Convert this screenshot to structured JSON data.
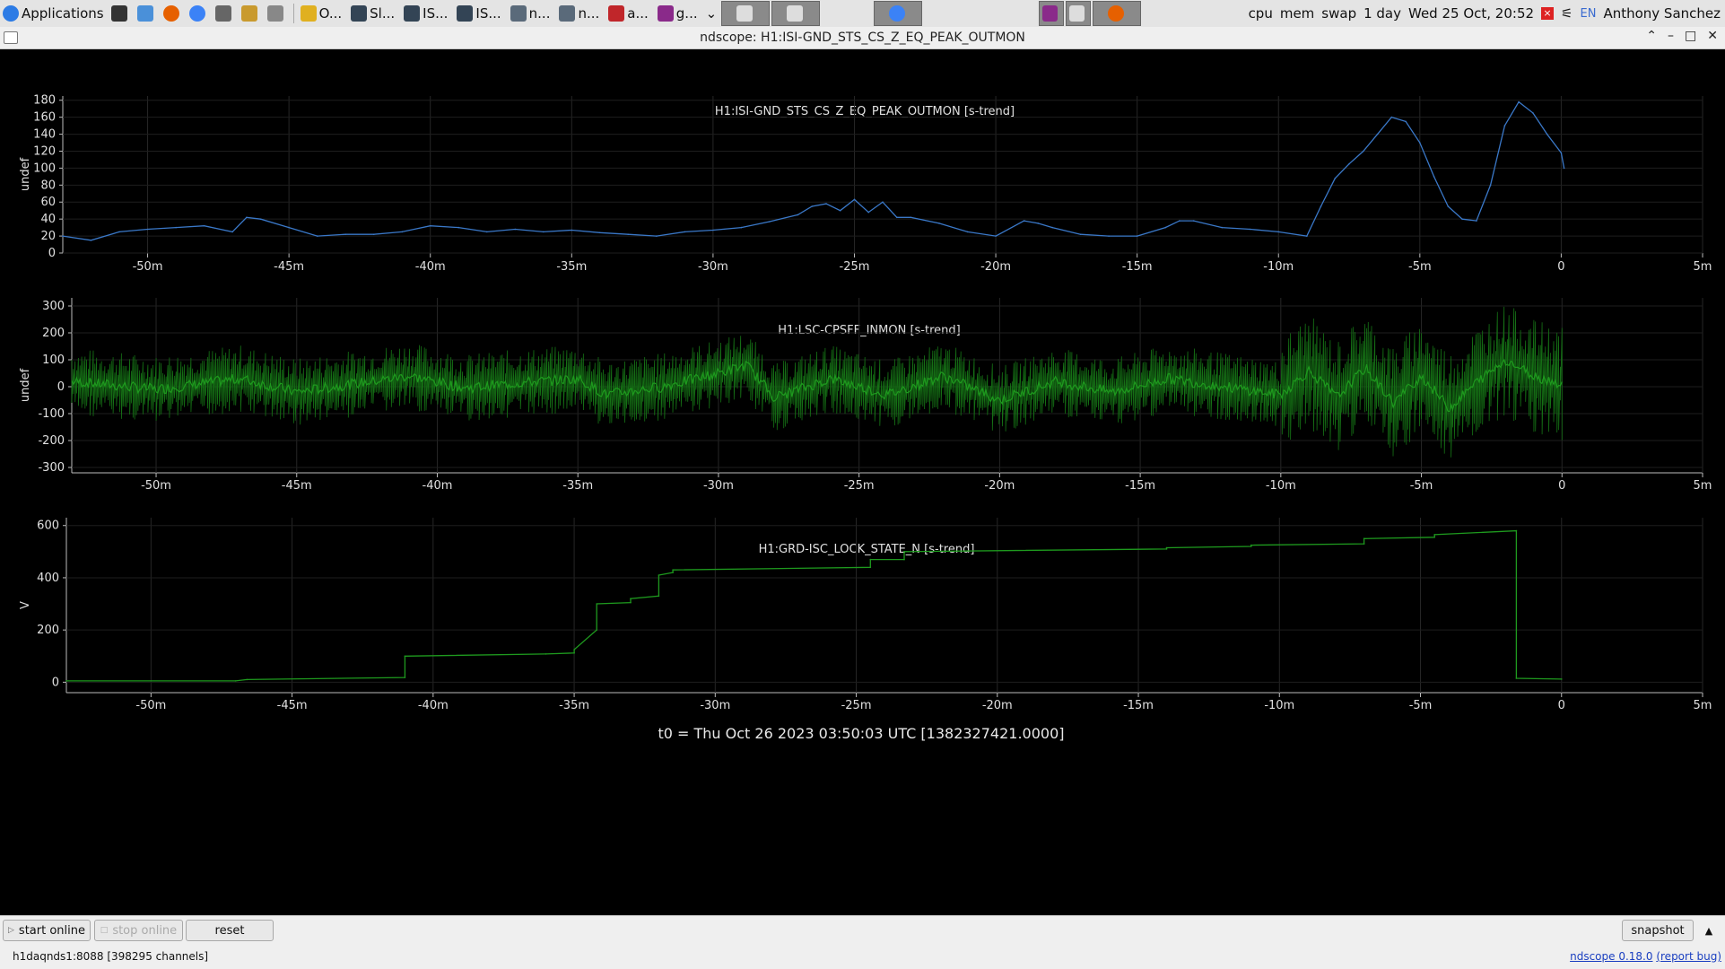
{
  "taskbar": {
    "apps_label": "Applications",
    "windows": [
      {
        "label": "O...",
        "icon": "editor-icon"
      },
      {
        "label": "Sl...",
        "icon": "monitor-icon"
      },
      {
        "label": "IS...",
        "icon": "monitor-icon"
      },
      {
        "label": "IS...",
        "icon": "monitor-icon"
      },
      {
        "label": "n...",
        "icon": "window-icon"
      },
      {
        "label": "n...",
        "icon": "window-icon"
      },
      {
        "label": "a...",
        "icon": "app-icon"
      },
      {
        "label": "g...",
        "icon": "app-icon"
      }
    ],
    "cpu": "cpu",
    "mem": "mem",
    "swap": "swap",
    "uptime": "1 day",
    "clock": "Wed 25 Oct, 20:52",
    "lang": "EN",
    "user": "Anthony Sanchez"
  },
  "window": {
    "title": "ndscope: H1:ISI-GND_STS_CS_Z_EQ_PEAK_OUTMON"
  },
  "t0_label": "t0 = Thu Oct 26 2023 03:50:03 UTC [1382327421.0000]",
  "x_ticks": [
    "-50m",
    "-45m",
    "-40m",
    "-35m",
    "-30m",
    "-25m",
    "-20m",
    "-15m",
    "-10m",
    "-5m",
    "0",
    "5m"
  ],
  "chart_data": [
    {
      "type": "line",
      "title": "H1:ISI-GND_STS_CS_Z_EQ_PEAK_OUTMON [s-trend]",
      "ylabel": "undef",
      "color": "#3a78c8",
      "xlim": [
        -53,
        5
      ],
      "ylim": [
        0,
        185
      ],
      "yticks": [
        "0",
        "20",
        "40",
        "60",
        "80",
        "100",
        "120",
        "140",
        "160",
        "180"
      ],
      "x": [
        -53,
        -52,
        -51,
        -50,
        -49,
        -48,
        -47,
        -46.5,
        -46,
        -45,
        -44,
        -43,
        -42,
        -41,
        -40,
        -39,
        -38,
        -37,
        -36,
        -35,
        -34,
        -33,
        -32,
        -31,
        -30,
        -29,
        -28,
        -27,
        -26.5,
        -26,
        -25.5,
        -25,
        -24.5,
        -24,
        -23.5,
        -23,
        -22,
        -21,
        -20,
        -19,
        -18.5,
        -18,
        -17,
        -16,
        -15,
        -14,
        -13.5,
        -13,
        -12,
        -11,
        -10,
        -9,
        -8.5,
        -8,
        -7.5,
        -7,
        -6.5,
        -6,
        -5.5,
        -5,
        -4.5,
        -4,
        -3.5,
        -3,
        -2.5,
        -2,
        -1.5,
        -1,
        -0.5,
        0,
        0.1
      ],
      "y": [
        20,
        15,
        25,
        28,
        30,
        32,
        25,
        42,
        40,
        30,
        20,
        22,
        22,
        25,
        32,
        30,
        25,
        28,
        25,
        27,
        24,
        22,
        20,
        25,
        27,
        30,
        37,
        45,
        55,
        58,
        50,
        63,
        48,
        60,
        42,
        42,
        35,
        25,
        20,
        38,
        35,
        30,
        22,
        20,
        20,
        30,
        38,
        38,
        30,
        28,
        25,
        20,
        55,
        88,
        105,
        120,
        140,
        160,
        155,
        130,
        90,
        55,
        40,
        38,
        80,
        150,
        178,
        165,
        140,
        118,
        100,
        95
      ]
    },
    {
      "type": "line",
      "title": "H1:LSC-CPSFF_INMON [s-trend]",
      "ylabel": "undef",
      "color": "#1e9a1e",
      "xlim": [
        -53,
        5
      ],
      "ylim": [
        -320,
        330
      ],
      "yticks": [
        "300",
        "200",
        "100",
        "0",
        "-100",
        "-200",
        "-300"
      ],
      "x": [
        -53,
        -50,
        -47,
        -45,
        -43,
        -41,
        -39,
        -37,
        -35,
        -34,
        -32,
        -30,
        -29,
        -28,
        -26,
        -24,
        -22,
        -20,
        -18,
        -16,
        -14,
        -12,
        -10,
        -9,
        -8,
        -7,
        -6,
        -5,
        -4,
        -3,
        -2,
        -1,
        0
      ],
      "y": [
        20,
        -10,
        30,
        -20,
        10,
        40,
        -5,
        15,
        30,
        -30,
        0,
        50,
        80,
        -40,
        30,
        -30,
        40,
        -50,
        20,
        -20,
        30,
        0,
        -30,
        60,
        -40,
        70,
        -60,
        40,
        -80,
        20,
        100,
        40,
        10
      ]
    },
    {
      "type": "line",
      "title": "H1:GRD-ISC_LOCK_STATE_N [s-trend]",
      "ylabel": "V",
      "color": "#1e9a1e",
      "xlim": [
        -53,
        5
      ],
      "ylim": [
        -40,
        630
      ],
      "yticks": [
        "600",
        "400",
        "200",
        "0"
      ],
      "x": [
        -53,
        -47,
        -46.6,
        -41,
        -41,
        -36,
        -35,
        -35,
        -34.2,
        -34.2,
        -33,
        -33,
        -32,
        -32,
        -31.5,
        -31.5,
        -24.5,
        -24.5,
        -23.3,
        -23.3,
        -14,
        -14,
        -11,
        -11,
        -7,
        -7,
        -4.5,
        -4.5,
        -1.6,
        -1.6,
        0
      ],
      "y": [
        5,
        5,
        10,
        18,
        100,
        108,
        112,
        125,
        200,
        300,
        305,
        320,
        330,
        410,
        420,
        430,
        440,
        470,
        470,
        500,
        510,
        515,
        520,
        525,
        530,
        550,
        555,
        565,
        580,
        15,
        12
      ]
    }
  ],
  "buttons": {
    "start_online": "start online",
    "stop_online": "stop online",
    "reset": "reset",
    "snapshot": "snapshot"
  },
  "status": {
    "server": "h1daqnds1:8088  [398295 channels]",
    "version": "ndscope 0.18.0",
    "report": "(report bug)"
  }
}
